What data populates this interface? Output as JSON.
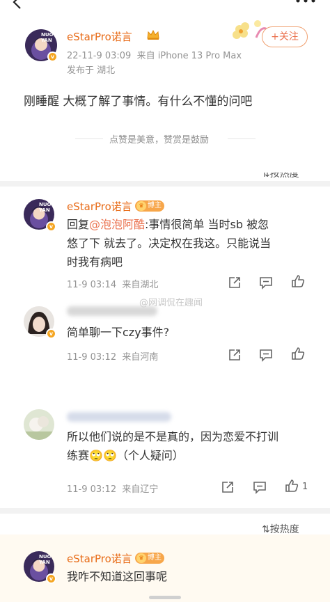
{
  "post": {
    "username": "eStarPro诺言",
    "avatar_text_1": "NUO",
    "avatar_text_2": "YAN",
    "timestamp": "22-11-9 03:09",
    "source": "来自 iPhone 13 Pro Max",
    "location": "发布于 湖北",
    "content": "刚睡醒 大概了解了事情。有什么不懂的问吧",
    "follow_label": "+关注",
    "like_hint": "点赞是美意，赞赏是鼓励"
  },
  "sort_label_top": "按热度",
  "comments": [
    {
      "username": "eStarPro诺言",
      "badge": "博主",
      "reply_prefix": "回复",
      "mention": "@泡泡阿酷",
      "text_after_mention": ":事情很简单 当时sb 被忽",
      "text_line2": "悠了下 就去了。决定权在我这。只能说当",
      "text_line3": "时我有病吧",
      "time": "11-9 03:14",
      "location": "来自湖北"
    },
    {
      "watermark": "@网调侃在趣闻",
      "text": "简单聊一下czy事件?",
      "time": "11-9 03:12",
      "location": "来自河南"
    },
    {
      "text_line1": "所以他们说的是不是真的，因为恋爱不打训",
      "text_line2_a": "练赛",
      "text_line2_emoji": "🙄🙄",
      "text_line2_b": "（个人疑问）",
      "time": "11-9 03:12",
      "location": "来自辽宁",
      "like_count": "1"
    }
  ],
  "sort_label_bottom": "按热度",
  "bottom_comment": {
    "username": "eStarPro诺言",
    "badge": "博主",
    "text": "我咋不知道这回事呢"
  },
  "icons": {
    "back": "back-arrow-icon",
    "more": "more-dots-icon",
    "share": "share-icon",
    "comment": "comment-icon",
    "like": "thumbs-up-icon",
    "sort": "sort-icon",
    "crown": "crown-icon",
    "verified": "verified-badge-icon"
  },
  "colors": {
    "accent": "#eb7350",
    "username": "#e86b17",
    "meta": "#939393",
    "badge": "#f7a64a"
  }
}
